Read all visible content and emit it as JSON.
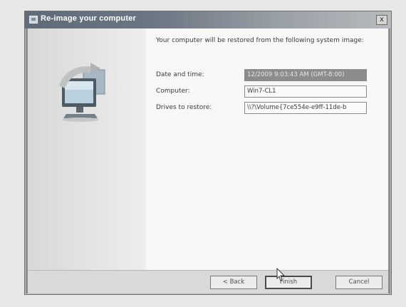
{
  "window": {
    "title": "Re-image your computer",
    "close_symbol": "x"
  },
  "main": {
    "intro": "Your computer will be restored from the following system image:",
    "fields": [
      {
        "label": "Date and time:",
        "value": "12/2009 9:03:43 AM (GMT-8:00)"
      },
      {
        "label": "Computer:",
        "value": "Win7-CL1"
      },
      {
        "label": "Drives to restore:",
        "value": "\\\\?\\Volume{7ce554e-e9ff-11de-b"
      }
    ]
  },
  "buttons": {
    "back": "< Back",
    "finish": "Finish",
    "cancel": "Cancel"
  },
  "icons": {
    "window": "restore-app-icon",
    "illustration": "restore-computer-illustration",
    "cursor": "mouse-pointer-icon"
  }
}
